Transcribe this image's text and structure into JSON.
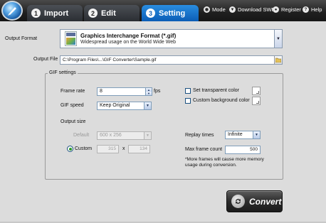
{
  "tabs": [
    {
      "num": "1",
      "label": "Import"
    },
    {
      "num": "2",
      "label": "Edit"
    },
    {
      "num": "3",
      "label": "Setting"
    }
  ],
  "active_tab": "Setting",
  "top_menu": {
    "mode": "Mode",
    "download": "Download SWF",
    "register": "Register",
    "help": "Help"
  },
  "output_format": {
    "label": "Output Format",
    "name": "Graphics Interchange Format (*.gif)",
    "description": "Widespread usage on the World Wide Web"
  },
  "output_file": {
    "label": "Output File",
    "value": "C:\\Program Files\\...\\GIF Converter\\Sample.gif"
  },
  "gif_settings": {
    "title": "GIF settings",
    "frame_rate_label": "Frame rate",
    "frame_rate_value": "8",
    "fps_label": "fps",
    "gif_speed_label": "GIF speed",
    "gif_speed_value": "Keep Original",
    "transparent_label": "Set transparent color",
    "custom_bg_label": "Custom background color",
    "output_size_label": "Output size",
    "default_label": "Default",
    "default_size_value": "600 x 256",
    "custom_label": "Custom",
    "custom_width": "315",
    "times_symbol": "x",
    "custom_height": "134",
    "replay_label": "Replay times",
    "replay_value": "Infinite",
    "max_frame_label": "Max frame count",
    "max_frame_value": "500",
    "note": "*More frames will cause more memory usage during conversion."
  },
  "convert_label": "Convert",
  "colors": {
    "topbar": "#1f1f1f",
    "active_tab": "#0b5db6",
    "background": "#dcdcdc"
  },
  "icons": [
    "app-logo-icon",
    "mode-icon",
    "download-icon",
    "register-icon",
    "help-icon",
    "gif-file-icon",
    "folder-icon",
    "convert-icon"
  ]
}
